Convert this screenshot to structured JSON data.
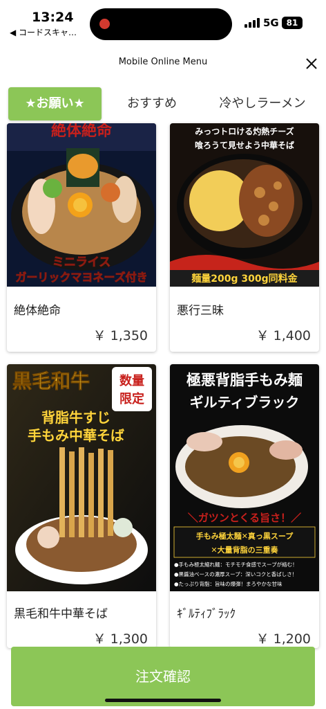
{
  "status_bar": {
    "time": "13:24",
    "back_app": "◀ コードスキャ…",
    "network": "5G",
    "battery": "81"
  },
  "header": {
    "title": "Mobile Online Menu",
    "close_icon": "close-icon"
  },
  "tabs": [
    {
      "label": "★お願い★",
      "active": true
    },
    {
      "label": "おすすめ",
      "active": false
    },
    {
      "label": "冷やしラーメン",
      "active": false
    }
  ],
  "products": [
    {
      "name": "絶体絶命",
      "price": "￥ 1,350",
      "image_text": {
        "top": "絶体絶命",
        "line1": "ミニライス",
        "line2": "ガーリックマヨネーズ付き"
      }
    },
    {
      "name": "悪行三昧",
      "price": "￥ 1,400",
      "image_text": {
        "line1": "みっつトロける灼熱チーズ",
        "line2": "喰ろうて見せよう中華そば",
        "bottom": "麺量200g 300g同料金"
      }
    },
    {
      "name": "黒毛和牛中華そば",
      "price": "￥ 1,300",
      "image_text": {
        "title": "黒毛和牛",
        "badge1": "数量",
        "badge2": "限定",
        "line1": "背脂牛すじ",
        "line2": "手もみ中華そば"
      }
    },
    {
      "name": "ｷﾞﾙﾃｨﾌﾞﾗｯｸ",
      "price": "￥ 1,200",
      "image_text": {
        "title": "極悪背脂手もみ麺",
        "subtitle": "ギルティブラック",
        "slogan": "＼ガツンとくる旨さ！／",
        "feature1": "手もみ極太麺✕真っ黒スープ",
        "feature2": "✕大量背脂の三重奏",
        "note1": "●手もみ極太縮れ麺：モチモチ食感でスープが絡む！",
        "note2": "●黒醤油ベースの濃厚スープ：深いコクと香ばしさ！",
        "note3": "●たっぷり背脂：旨味の爆弾！まろやかな甘味"
      }
    }
  ],
  "footer": {
    "confirm_label": "注文確認"
  },
  "colors": {
    "accent_green": "#8cc657",
    "text_dark": "#222222"
  }
}
